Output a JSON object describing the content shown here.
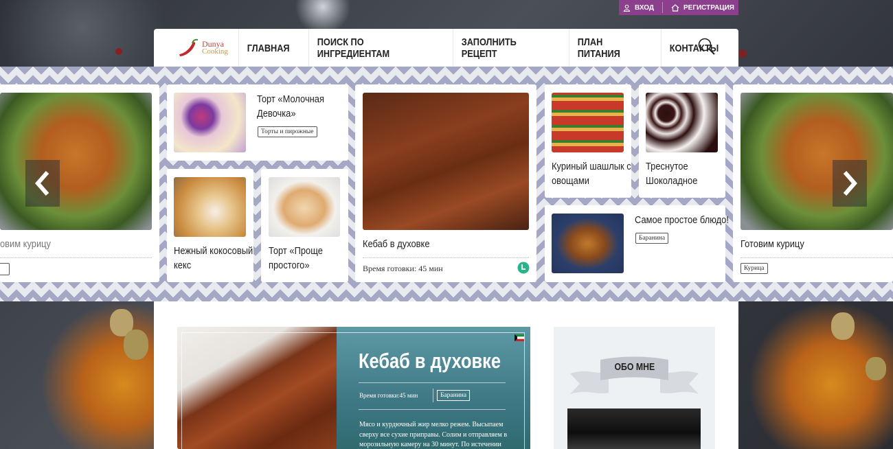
{
  "top_bar": {
    "login": "ВХОД",
    "register": "РЕГИСТРАЦИЯ"
  },
  "logo": {
    "line1": "Dunya",
    "line2": "Cooking"
  },
  "nav": [
    "ГЛАВНАЯ",
    "ПОИСК ПО ИНГРЕДИЕНТАМ",
    "ЗАПОЛНИТЬ РЕЦЕПТ",
    "ПЛАН ПИТАНИЯ",
    "КОНТАКТЫ"
  ],
  "slider": {
    "left_partial": {
      "title": "овим курицу"
    },
    "card1": {
      "title_l1": "Торт «Молочная",
      "title_l2": "Девочка»",
      "tag": "Торты и пирожные"
    },
    "card2": {
      "title_l1": "Нежный кокосовый",
      "title_l2": "кекс"
    },
    "card3": {
      "title_l1": "Торт «Проще",
      "title_l2": "простого»"
    },
    "card_big": {
      "title": "Кебаб в духовке",
      "time": "Время готовки: 45 мин"
    },
    "card4": {
      "title_l1": "Куриный шашлык с",
      "title_l2": "овощами"
    },
    "card5": {
      "title_l1": "Треснутое",
      "title_l2": "Шоколадное"
    },
    "card6": {
      "title": "Самое простое блюдо!",
      "tag": "Баранина"
    },
    "card_right": {
      "title": "Готовим курицу",
      "tag": "Курица"
    }
  },
  "feature": {
    "title": "Кебаб в духовке",
    "time": "Время готовки:45 мин",
    "tag": "Баранина",
    "text_l1": "Мясо и курдючный жир мелко режем. Высыпаем",
    "text_l2": "сверху все сухие приправы. Солим и отправляем в",
    "text_l3": "морозильную камеру на 30 минут. По истечении"
  },
  "about": {
    "title": "ОБО МНЕ"
  },
  "colors": {
    "accent": "#8c3f8c",
    "pattern": "#a4a8c4",
    "teal": "#3f7885"
  }
}
